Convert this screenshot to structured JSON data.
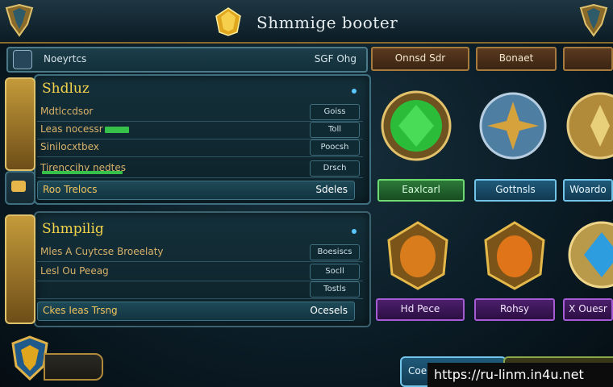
{
  "title": "Shmmige booter",
  "toolbar": {
    "search_label": "Noeyrtcs",
    "search_value": "SGF Ohg",
    "btn1": "Onnsd Sdr",
    "btn2": "Bonaet"
  },
  "section1": {
    "title": "Shdluz",
    "rows": [
      {
        "label": "Mdtlccdsor",
        "value": "Goiss"
      },
      {
        "label": "Leas nocessr",
        "value": "Toll"
      },
      {
        "label": "Sinilocxtbex",
        "value": "Poocsh"
      },
      {
        "label": "Tirenccihy nedtes",
        "value": "Drsch"
      }
    ],
    "footer_label": "Roo Trelocs",
    "footer_value": "Sdeles"
  },
  "section2": {
    "title": "Shmpilig",
    "rows": [
      {
        "label": "Mles A Cuytcse Broeelaty",
        "value": "Boesiscs"
      },
      {
        "label": "Lesl Ou Peeag",
        "value": "Socll"
      },
      {
        "label": "",
        "value": "Tostls"
      }
    ],
    "footer_label": "Ckes Ieas Trsng",
    "footer_value": "Ocesels"
  },
  "items_row1": [
    {
      "name": "green-gem",
      "button": "Eaxlcarl",
      "style": "green",
      "color": "#2bbd3a"
    },
    {
      "name": "blue-star-medal",
      "button": "Gottnsls",
      "style": "blue",
      "color": "#4e7fa3"
    },
    {
      "name": "gold-medal",
      "button": "Woardo",
      "style": "blue",
      "color": "#b28b3a"
    }
  ],
  "items_row2": [
    {
      "name": "amber-gem",
      "button": "Hd Pece",
      "style": "purple",
      "color": "#d97c1c"
    },
    {
      "name": "orange-gem",
      "button": "Rohsy",
      "style": "purple",
      "color": "#e07418"
    },
    {
      "name": "blue-gem",
      "button": "X Ouesr",
      "style": "purple",
      "color": "#2e9de0"
    }
  ],
  "bottom": {
    "button1": "Coe",
    "watermark": "https://ru-linm.in4u.net"
  },
  "colors": {
    "accent_gold": "#f3d34a",
    "frame_gold": "#b08a3a",
    "panel_border": "#3c6270"
  }
}
